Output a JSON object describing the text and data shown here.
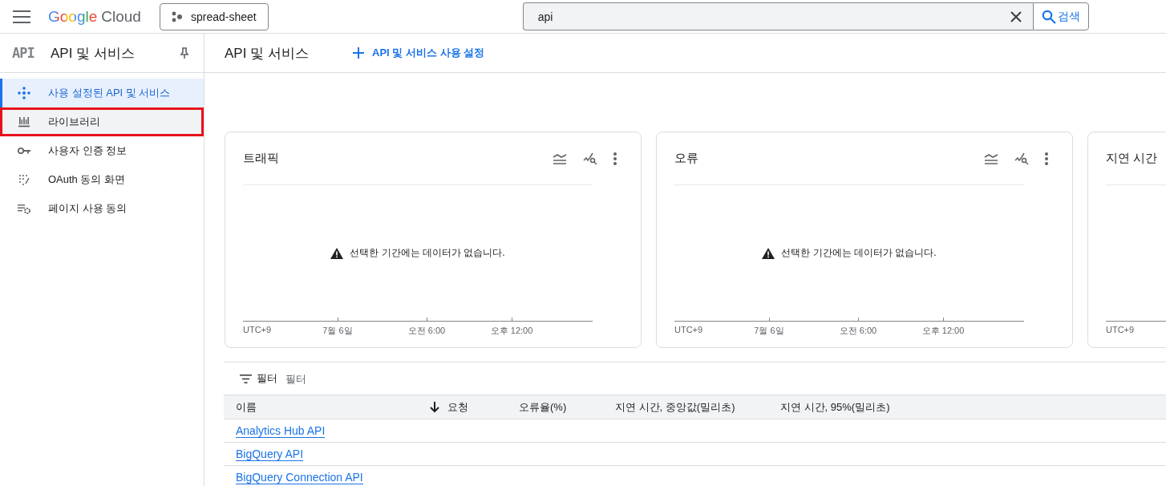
{
  "topbar": {
    "logo": {
      "brand": "Google",
      "product": "Cloud"
    },
    "project": "spread-sheet",
    "search": {
      "value": "api",
      "button": "검색"
    }
  },
  "sidebar": {
    "badge": "API",
    "title": "API 및 서비스",
    "items": [
      {
        "label": "사용 설정된 API 및 서비스",
        "selected": true,
        "highlighted": false
      },
      {
        "label": "라이브러리",
        "selected": false,
        "highlighted": true
      },
      {
        "label": "사용자 인증 정보",
        "selected": false,
        "highlighted": false
      },
      {
        "label": "OAuth 동의 화면",
        "selected": false,
        "highlighted": false
      },
      {
        "label": "페이지 사용 동의",
        "selected": false,
        "highlighted": false
      }
    ]
  },
  "page": {
    "title": "API 및 서비스",
    "action": "API 및 서비스 사용 설정"
  },
  "cards": [
    {
      "title": "트래픽",
      "tools": true,
      "message": "선택한 기간에는 데이터가 없습니다.",
      "axis_labels": [
        "UTC+9",
        "7월 6일",
        "오전 6:00",
        "오후 12:00"
      ]
    },
    {
      "title": "오류",
      "tools": true,
      "message": "선택한 기간에는 데이터가 없습니다.",
      "axis_labels": [
        "UTC+9",
        "7월 6일",
        "오전 6:00",
        "오후 12:00"
      ]
    },
    {
      "title": "지연 시간",
      "axis_labels": [
        "UTC+9"
      ]
    }
  ],
  "filter": {
    "button": "필터",
    "placeholder": "필터"
  },
  "table": {
    "columns": [
      {
        "label": "이름",
        "sorted": false
      },
      {
        "label": "요청",
        "sorted": true
      },
      {
        "label": "오류율(%)",
        "sorted": false
      },
      {
        "label": "지연 시간, 중앙값(밀리초)",
        "sorted": false
      },
      {
        "label": "지연 시간, 95%(밀리초)",
        "sorted": false
      }
    ],
    "rows": [
      {
        "name": "Analytics Hub API"
      },
      {
        "name": "BigQuery API"
      },
      {
        "name": "BigQuery Connection API"
      }
    ]
  }
}
